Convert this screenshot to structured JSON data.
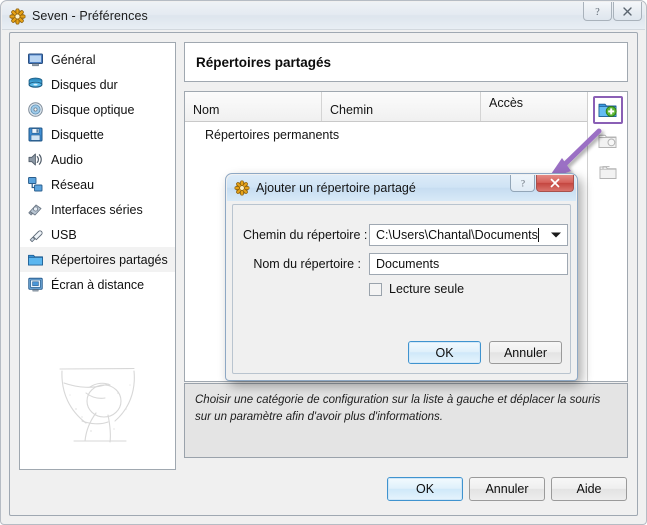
{
  "window": {
    "title": "Seven - Préférences",
    "title_icon": "gear-icon",
    "caption": {
      "help_label": "?",
      "close_label": "✕"
    }
  },
  "sidebar": {
    "items": [
      {
        "label": "Général",
        "icon": "monitor-icon",
        "selected": false
      },
      {
        "label": "Disques dur",
        "icon": "harddisk-icon",
        "selected": false
      },
      {
        "label": "Disque optique",
        "icon": "cd-icon",
        "selected": false
      },
      {
        "label": "Disquette",
        "icon": "floppy-icon",
        "selected": false
      },
      {
        "label": "Audio",
        "icon": "speaker-icon",
        "selected": false
      },
      {
        "label": "Réseau",
        "icon": "network-icon",
        "selected": false
      },
      {
        "label": "Interfaces séries",
        "icon": "serial-port-icon",
        "selected": false
      },
      {
        "label": "USB",
        "icon": "usb-icon",
        "selected": false
      },
      {
        "label": "Répertoires partagés",
        "icon": "folder-icon",
        "selected": true
      },
      {
        "label": "Écran à distance",
        "icon": "remote-screen-icon",
        "selected": false
      }
    ],
    "watermark_icon": "decorative-sketch-watermark"
  },
  "main": {
    "page_title": "Répertoires partagés",
    "table": {
      "columns": [
        "Nom",
        "Chemin",
        "Accès"
      ],
      "rows": [
        {
          "name": "Répertoires permanents",
          "path": "",
          "access": ""
        }
      ]
    },
    "toolbar": [
      {
        "name": "add-shared-folder-button",
        "icon": "folder-add-icon",
        "highlighted": true,
        "enabled": true
      },
      {
        "name": "edit-shared-folder-button",
        "icon": "folder-edit-icon",
        "highlighted": false,
        "enabled": false
      },
      {
        "name": "remove-shared-folder-button",
        "icon": "folder-remove-icon",
        "highlighted": false,
        "enabled": false
      }
    ],
    "annotation": {
      "arrow_color": "#9b6fc4",
      "points_to": "add-shared-folder-button"
    },
    "hint": "Choisir une catégorie de configuration sur la liste à gauche et déplacer la souris sur un paramètre afin d'avoir plus d'informations.",
    "footer_buttons": [
      {
        "label": "OK",
        "default": true
      },
      {
        "label": "Annuler",
        "default": false
      },
      {
        "label": "Aide",
        "default": false
      }
    ]
  },
  "dialog": {
    "title": "Ajouter un répertoire partagé",
    "title_icon": "gear-icon",
    "caption": {
      "help_label": "?",
      "close_label": "✕"
    },
    "fields": {
      "path": {
        "label": "Chemin du répertoire :",
        "value": "C:\\Users\\Chantal\\Documents",
        "placeholder": "",
        "type": "combobox"
      },
      "name": {
        "label": "Nom du répertoire :",
        "value": "Documents",
        "placeholder": "",
        "type": "text"
      },
      "readonly": {
        "label": "Lecture seule",
        "checked": false
      }
    },
    "buttons": [
      {
        "label": "OK",
        "default": true
      },
      {
        "label": "Annuler",
        "default": false
      }
    ]
  },
  "colors": {
    "accent_highlight": "#8a5fb5",
    "annotation_arrow": "#9b6fc4",
    "default_button_border": "#3f93cf",
    "dialog_close_red": "#c4453f",
    "window_bg": "#f0f0f0"
  }
}
